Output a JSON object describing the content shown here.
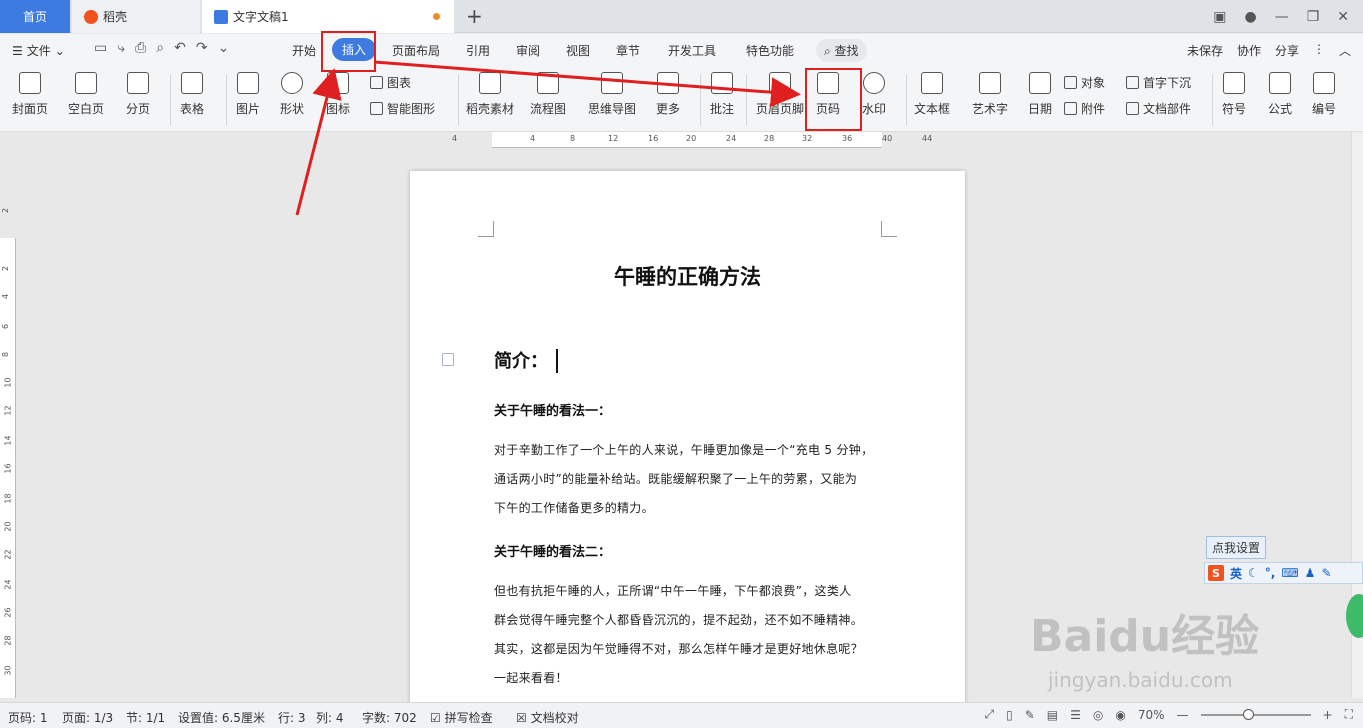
{
  "tabs": {
    "home": "首页",
    "daoke": "稻壳",
    "doc": "文字文稿1",
    "new": "+"
  },
  "menu": {
    "file": "文件",
    "tabs": [
      "开始",
      "插入",
      "页面布局",
      "引用",
      "审阅",
      "视图",
      "章节",
      "开发工具",
      "特色功能"
    ],
    "search": "查找",
    "right": [
      "未保存",
      "协作",
      "分享"
    ]
  },
  "ribbon": {
    "cover": "封面页",
    "blank": "空白页",
    "pagebreak": "分页",
    "table": "表格",
    "picture": "图片",
    "shape": "形状",
    "icon": "图标",
    "chart": "图表",
    "smartart": "智能图形",
    "daoke_material": "稻壳素材",
    "flowchart": "流程图",
    "mindmap": "思维导图",
    "more": "更多",
    "comment": "批注",
    "header_footer": "页眉页脚",
    "page_number": "页码",
    "watermark": "水印",
    "textbox": "文本框",
    "wordart": "艺术字",
    "date": "日期",
    "object": "对象",
    "attachment": "附件",
    "dropcap": "首字下沉",
    "docparts": "文档部件",
    "symbol": "符号",
    "formula": "公式",
    "numbering": "编号"
  },
  "ruler": {
    "top": [
      "4",
      "4",
      "8",
      "12",
      "16",
      "20",
      "24",
      "28",
      "32",
      "36",
      "40",
      "44"
    ],
    "left": [
      "2",
      "2",
      "4",
      "6",
      "8",
      "10",
      "12",
      "14",
      "16",
      "18",
      "20",
      "22",
      "24",
      "26",
      "28",
      "30"
    ]
  },
  "doc": {
    "title": "午睡的正确方法",
    "intro": "简介：",
    "h1": "关于午睡的看法一：",
    "p1": [
      "对于辛勤工作了一个上午的人来说，午睡更加像是一个“充电 5 分钟，",
      "通话两小时”的能量补给站。既能缓解积聚了一上午的劳累，又能为",
      "下午的工作储备更多的精力。"
    ],
    "h2": "关于午睡的看法二：",
    "p2": [
      "但也有抗拒午睡的人，正所谓“中午一午睡，下午都浪费”，这类人",
      "群会觉得午睡完整个人都昏昏沉沉的，提不起劲，还不如不睡精神。",
      "其实，这都是因为午觉睡得不对，那么怎样午睡才是更好地休息呢？",
      "一起来看看！"
    ]
  },
  "ime": {
    "tip": "点我设置",
    "lang": "英",
    "logo": "S"
  },
  "watermark": {
    "brand": "Baidu经验",
    "url": "jingyan.baidu.com"
  },
  "status": {
    "page": "页码: 1",
    "pages": "页面: 1/3",
    "section": "节: 1/1",
    "setting": "设置值: 6.5厘米",
    "row": "行: 3",
    "col": "列: 4",
    "words": "字数: 702",
    "spell": "拼写检查",
    "proof": "文档校对",
    "zoom": "70%"
  },
  "colors": {
    "accent": "#3d7be0",
    "highlight": "#e02020"
  }
}
